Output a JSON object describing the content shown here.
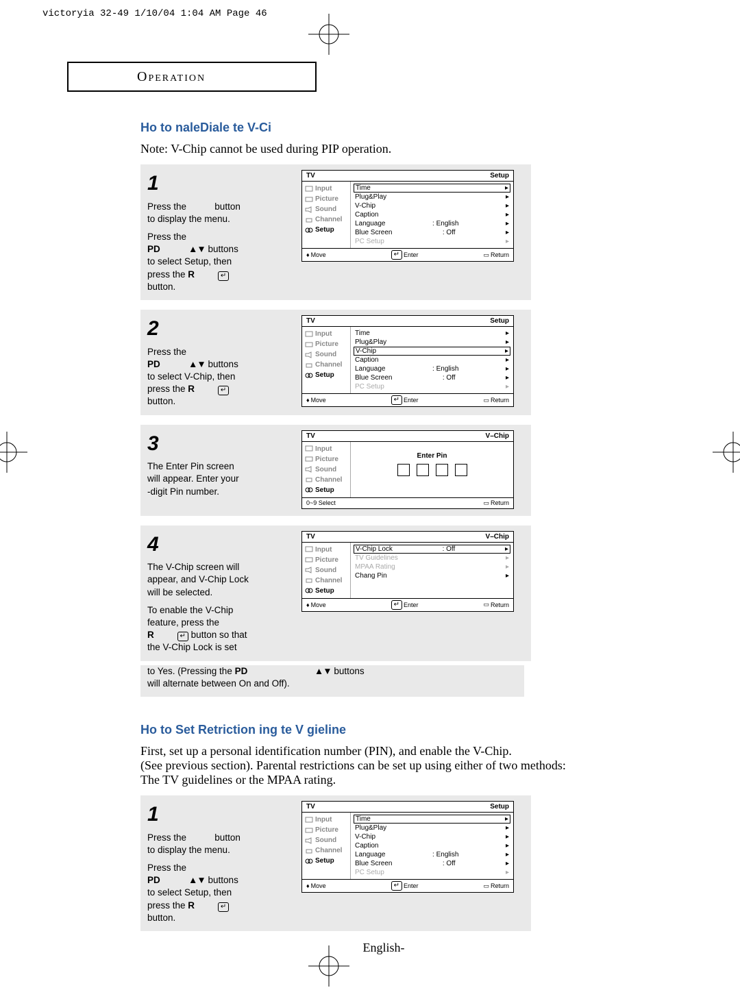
{
  "header_line": "victoryia 32-49  1/10/04 1:04 AM  Page 46",
  "section_title": "Operation",
  "heading1": "Ho to naleDiale te V-Ci",
  "note_text": "Note: V-Chip cannot be used during PIP operation.",
  "heading2": "Ho to Set  Retriction ing te V gieline",
  "body2_l1": "First, set up a personal identification number (PIN), and enable the V-Chip.",
  "body2_l2": "(See previous section). Parental restrictions can be set up using either of two methods:",
  "body2_l3": "The TV guidelines or the MPAA rating.",
  "footer": "English-",
  "labels": {
    "press_the": "Press the",
    "button": "button",
    "pd": "PD",
    "updown_buttons": "buttons",
    "r": "R",
    "button_word": "button."
  },
  "step1_a": {
    "l1a": "Press the",
    "l1b": "button",
    "l2": "to display the menu.",
    "l3": "Press the",
    "l4a": "PD",
    "l4b": "▲▼",
    "l4c": "buttons",
    "l5": "to select Setup, then",
    "l6a": "press the",
    "l6b": "R",
    "l7": "button."
  },
  "step2": {
    "l1": "Press the",
    "l2a": "PD",
    "l2b": "▲▼",
    "l2c": "buttons",
    "l3": "to select V-Chip, then",
    "l4a": "press the",
    "l4b": "R",
    "l5": "button."
  },
  "step3": {
    "l1": "The Enter Pin screen",
    "l2": "will appear. Enter your",
    "l3": "-digit Pin number."
  },
  "step4": {
    "l1": "The V-Chip screen will",
    "l2": "appear, and V-Chip Lock",
    "l3": "will be selected.",
    "l4": "To enable the V-Chip",
    "l5": "feature, press the",
    "l6a": "R",
    "l6b": "button so that",
    "l7": "the V-Chip Lock is set",
    "l8a": "to Yes. (Pressing the",
    "l8b": "PD",
    "l8c": "▲▼",
    "l8d": "buttons",
    "l9": "will alternate between On and Off)."
  },
  "tv": {
    "title": "TV",
    "setup": "Setup",
    "vchip": "V–Chip",
    "side": {
      "input": "Input",
      "picture": "Picture",
      "sound": "Sound",
      "channel": "Channel",
      "setup_lbl": "Setup"
    },
    "setup_items": {
      "time": "Time",
      "plugplay": "Plug&Play",
      "vchip": "V-Chip",
      "caption": "Caption",
      "language": "Language",
      "english": ":    English",
      "bluescreen": "Blue Screen",
      "off": ":    Off",
      "pcsetup": "PC Setup"
    },
    "vchip_items": {
      "lock": "V-Chip Lock",
      "lock_off": ":    Off",
      "tvg": "TV Guidelines",
      "mpaa": "MPAA Rating",
      "changepin": "Chang Pin"
    },
    "pin": {
      "label": "Enter Pin"
    },
    "footer": {
      "move": "Move",
      "enter": "Enter",
      "return": "Return",
      "select": "0~9 Select"
    }
  }
}
